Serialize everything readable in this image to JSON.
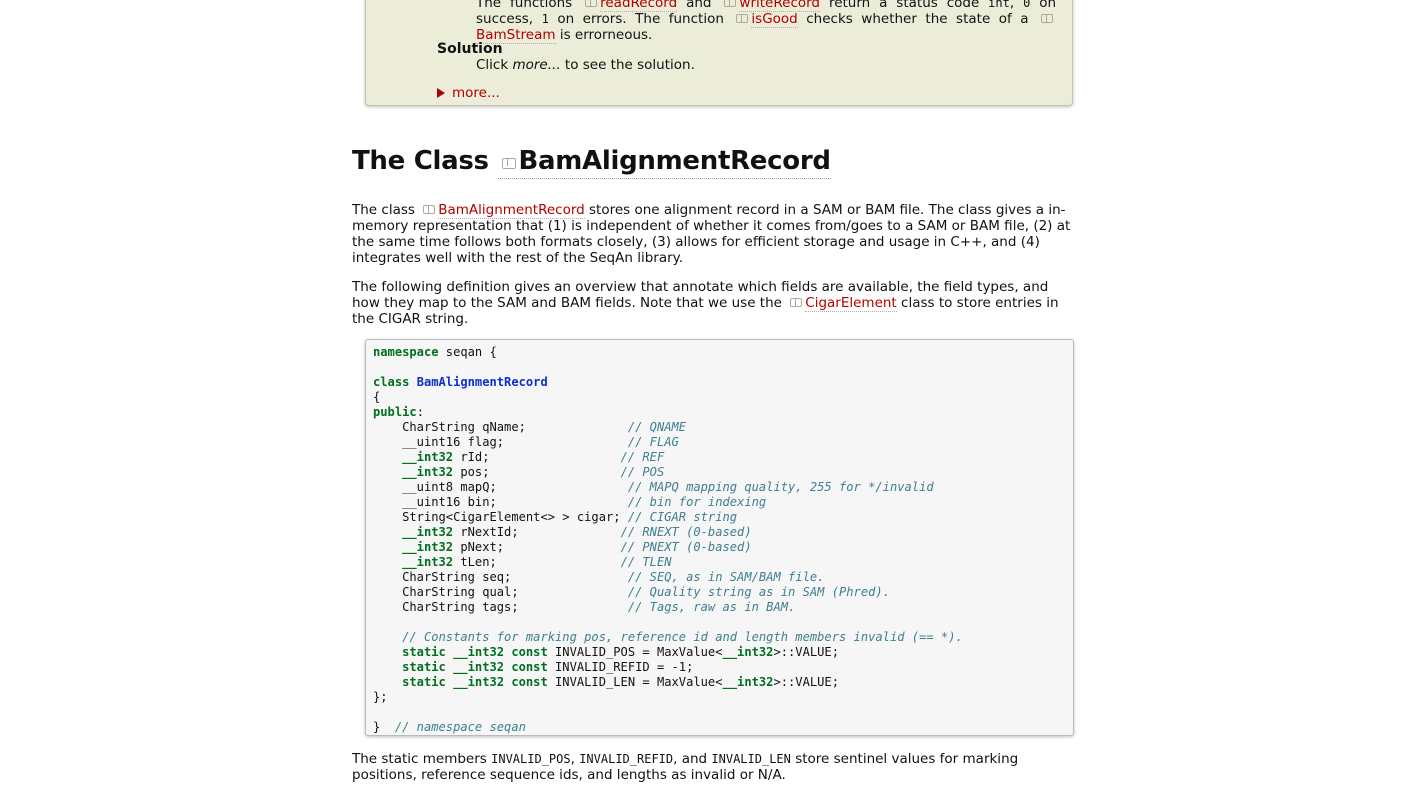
{
  "assignment": {
    "hint_line1_pre": "The functions",
    "hint_fn1": "readRecord",
    "hint_and": "and",
    "hint_fn2": "writeRecord",
    "hint_line1_post": "return a status code",
    "hint_int": "int",
    "hint_zero": "0",
    "hint_on": "on",
    "hint_line2_pre": "success,",
    "hint_one": "1",
    "hint_line2_mid": "on errors. The function",
    "hint_fn3": "isGood",
    "hint_line2_post": "checks whether the state of a",
    "hint_class": "BamStream",
    "hint_line3_post": "is errorneous.",
    "solution_heading": "Solution",
    "solution_pre": "Click",
    "solution_em": "more...",
    "solution_post": "to see the solution.",
    "more_link": "more..."
  },
  "section": {
    "title_prefix": "The Class",
    "title_class": "BamAlignmentRecord"
  },
  "paragraph1": {
    "pre": "The class",
    "link": "BamAlignmentRecord",
    "post": "stores one alignment record in a SAM or BAM file. The class gives a in-memory representation that (1) is independent of whether it comes from/goes to a SAM or BAM file, (2) at the same time follows both formats closely, (3) allows for efficient storage and usage in C++, and (4) integrates well with the rest of the SeqAn library."
  },
  "paragraph2": {
    "pre": "The following definition gives an overview that annotate which fields are available, the field types, and how they map to the SAM and BAM fields. Note that we use the",
    "link": "CigarElement",
    "post": "class to store entries in the CIGAR string."
  },
  "code": {
    "ns_kw": "namespace",
    "ns_name": " seqan {",
    "class_kw": "class",
    "class_name": "BamAlignmentRecord",
    "open_brace": "{",
    "public_kw": "public",
    "colon": ":",
    "fields": [
      {
        "pre": "    CharString qName;",
        "kw": "",
        "post": "",
        "pad": "              ",
        "comment": "// QNAME"
      },
      {
        "pre": "    __uint16 flag;",
        "kw": "",
        "post": "",
        "pad": "                 ",
        "comment": "// FLAG"
      },
      {
        "pre": "    ",
        "kw": "__int32",
        "post": " rId;",
        "pad": "                  ",
        "comment": "// REF"
      },
      {
        "pre": "    ",
        "kw": "__int32",
        "post": " pos;",
        "pad": "                  ",
        "comment": "// POS"
      },
      {
        "pre": "    __uint8 mapQ;",
        "kw": "",
        "post": "",
        "pad": "                  ",
        "comment": "// MAPQ mapping quality, 255 for */invalid"
      },
      {
        "pre": "    __uint16 bin;",
        "kw": "",
        "post": "",
        "pad": "                  ",
        "comment": "// bin for indexing"
      },
      {
        "pre": "    String<CigarElement<> > cigar;",
        "kw": "",
        "post": "",
        "pad": " ",
        "comment": "// CIGAR string"
      },
      {
        "pre": "    ",
        "kw": "__int32",
        "post": " rNextId;",
        "pad": "              ",
        "comment": "// RNEXT (0-based)"
      },
      {
        "pre": "    ",
        "kw": "__int32",
        "post": " pNext;",
        "pad": "                ",
        "comment": "// PNEXT (0-based)"
      },
      {
        "pre": "    ",
        "kw": "__int32",
        "post": " tLen;",
        "pad": "                 ",
        "comment": "// TLEN"
      },
      {
        "pre": "    CharString seq;",
        "kw": "",
        "post": "",
        "pad": "                ",
        "comment": "// SEQ, as in SAM/BAM file."
      },
      {
        "pre": "    CharString qual;",
        "kw": "",
        "post": "",
        "pad": "               ",
        "comment": "// Quality string as in SAM (Phred)."
      },
      {
        "pre": "    CharString tags;",
        "kw": "",
        "post": "",
        "pad": "               ",
        "comment": "// Tags, raw as in BAM."
      }
    ],
    "constants_comment": "    // Constants for marking pos, reference id and length members invalid (== *).",
    "constants": [
      {
        "name": " INVALID_POS = MaxValue<",
        "tmpl": "__int32",
        "rest": ">::VALUE;"
      },
      {
        "name": " INVALID_REFID = -1;",
        "tmpl": "",
        "rest": ""
      },
      {
        "name": " INVALID_LEN = MaxValue<",
        "tmpl": "__int32",
        "rest": ">::VALUE;"
      }
    ],
    "static_kw": "static",
    "int_kw": "__int32",
    "const_kw": "const",
    "close_class": "};",
    "close_ns": "}",
    "ns_comment": "// namespace seqan"
  },
  "paragraph3": {
    "pre": "The static members",
    "c1": "INVALID_POS",
    "sep1": ",",
    "c2": "INVALID_REFID",
    "sep2": ", and",
    "c3": "INVALID_LEN",
    "post": "store sentinel values for marking positions, reference sequence ids, and lengths as invalid or N/A."
  }
}
